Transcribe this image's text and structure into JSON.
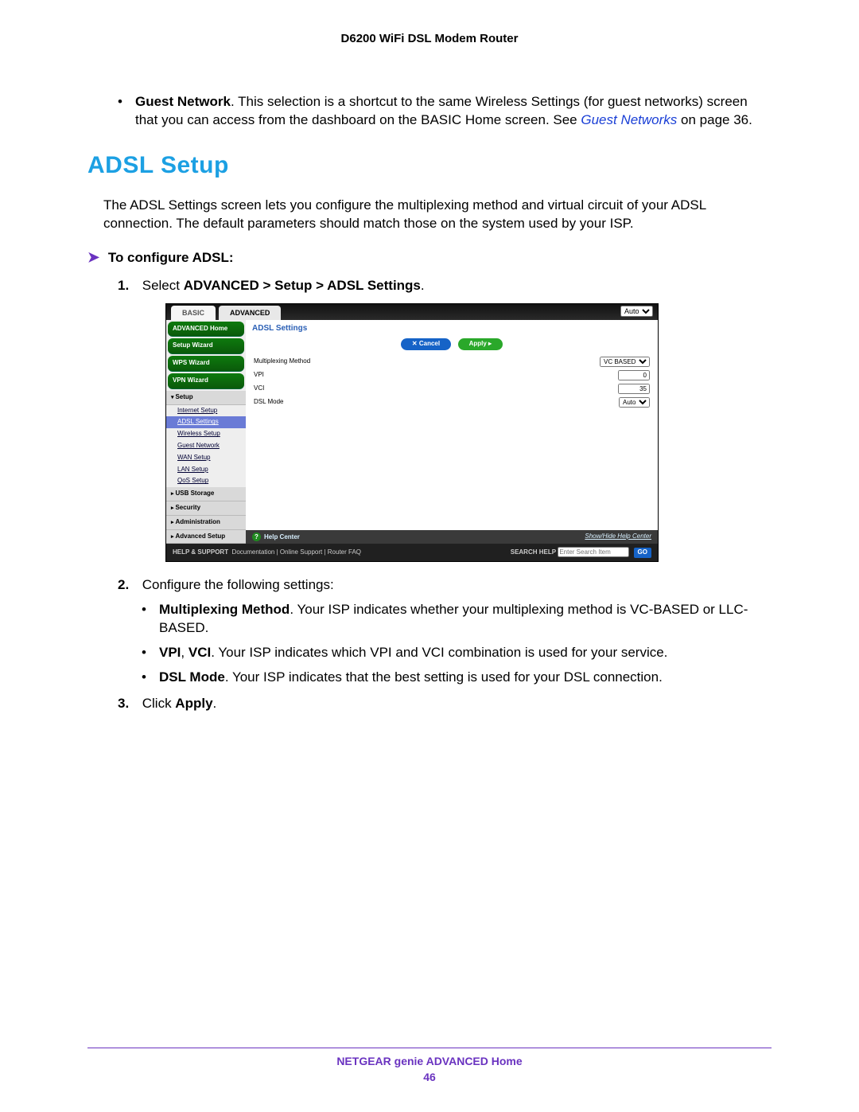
{
  "header": {
    "title": "D6200 WiFi DSL Modem Router"
  },
  "intro_bullet": {
    "label": "Guest Network",
    "text": ". This selection is a shortcut to the same Wireless Settings (for guest networks) screen that you can access from the dashboard on the BASIC Home screen. See ",
    "link": "Guest Networks",
    "tail": " on page 36."
  },
  "section_heading": "ADSL Setup",
  "section_para": "The ADSL Settings screen lets you configure the multiplexing method and virtual circuit of your ADSL connection. The default parameters should match those on the system used by your ISP.",
  "task_label": "To configure ADSL:",
  "steps": {
    "s1": {
      "num": "1.",
      "pre": "Select ",
      "bold": "ADVANCED > Setup > ADSL Settings",
      "post": "."
    },
    "s2": {
      "num": "2.",
      "text": "Configure the following settings:"
    },
    "s2_bullets": {
      "b1": {
        "label": "Multiplexing Method",
        "text": ". Your ISP indicates whether your multiplexing method is VC-BASED or LLC-BASED."
      },
      "b2": {
        "label": "VPI",
        "mid": ", ",
        "label2": "VCI",
        "text": ". Your ISP indicates which VPI and VCI combination is used for your service."
      },
      "b3": {
        "label": "DSL Mode",
        "text": ". Your ISP indicates that the best setting is used for your DSL connection."
      }
    },
    "s3": {
      "num": "3.",
      "pre": "Click ",
      "bold": "Apply",
      "post": "."
    }
  },
  "ui": {
    "top_select": "Auto",
    "tabs": {
      "basic": "BASIC",
      "advanced": "ADVANCED"
    },
    "side": {
      "buttons": [
        "ADVANCED Home",
        "Setup Wizard",
        "WPS Wizard",
        "VPN Wizard"
      ],
      "setup_label": "Setup",
      "setup_items": [
        "Internet Setup",
        "ADSL Settings",
        "Wireless Setup",
        "Guest Network",
        "WAN Setup",
        "LAN Setup",
        "QoS Setup"
      ],
      "sections": [
        "USB Storage",
        "Security",
        "Administration",
        "Advanced Setup"
      ]
    },
    "main": {
      "title": "ADSL Settings",
      "cancel": "Cancel",
      "apply": "Apply",
      "rows": {
        "mux": {
          "label": "Multiplexing Method",
          "value": "VC BASED"
        },
        "vpi": {
          "label": "VPI",
          "value": "0"
        },
        "vci": {
          "label": "VCI",
          "value": "35"
        },
        "dsl": {
          "label": "DSL Mode",
          "value": "Auto"
        }
      },
      "help_center": "Help Center",
      "help_toggle": "Show/Hide Help Center"
    },
    "footer": {
      "left_label": "HELP & SUPPORT",
      "links": "Documentation  |  Online Support  |  Router FAQ",
      "search_label": "SEARCH HELP",
      "search_placeholder": "Enter Search Item",
      "go": "GO"
    }
  },
  "footer": {
    "line": "NETGEAR genie ADVANCED Home",
    "page": "46"
  }
}
